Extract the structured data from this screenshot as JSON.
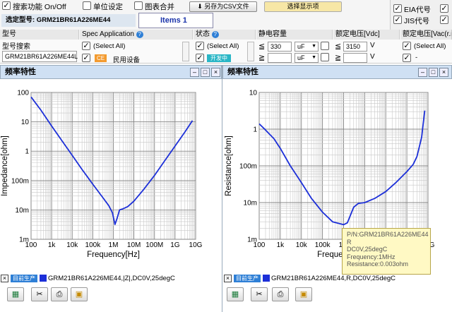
{
  "topbar": {
    "search_toggle": "搜索功能 On/Off",
    "unit_setting": "单位设定",
    "chart_merge": "图表合并",
    "csv_button": "另存为CSV文件",
    "select_display_button": "选择显示项",
    "selected_label": "选定型号: GRM21BR61A226ME44",
    "items_count": "Items 1",
    "right_options": [
      "EIA代号",
      "JIS代号"
    ]
  },
  "filters": {
    "col_model": "型号",
    "model_search_label": "型号搜索",
    "model_search_value": "GRM21BR61A226ME44L",
    "col_spec": "Spec Application",
    "spec_select_all": "(Select All)",
    "spec_ce_badge": "CE",
    "spec_item1": "民用设备",
    "col_status": "状态",
    "status_select_all": "(Select All)",
    "status_item1": "开发中",
    "col_capacitance": "静电容量",
    "cap_op1": "≦",
    "cap_value": "330",
    "cap_unit": "uF",
    "cap_op2": "≧",
    "col_voltage": "额定电压[Vdc]",
    "volt_op1": "≦",
    "volt_value": "3150",
    "volt_unit": "V",
    "volt_op2": "≧",
    "col_voltage_ac": "额定电压[Vac(r.m",
    "vac_select_all": "(Select All)",
    "vac_item1": "-"
  },
  "left_panel": {
    "title": "频率特性",
    "legend_badge": "目前生产",
    "legend_text": "GRM21BR61A226ME44,|Z|,DC0V,25degC"
  },
  "right_panel": {
    "title": "频率特性",
    "legend_badge": "目前生产",
    "legend_text": "GRM21BR61A226ME44,R,DC0V,25degC"
  },
  "tooltip": {
    "lines": [
      "P/N:GRM21BR61A226ME44",
      "R",
      "DC0V,25degC",
      "Frequency:1MHz",
      "Resistance:0.003ohm"
    ]
  },
  "toolbar_icons": [
    "excel-icon",
    "tools-icon",
    "print-icon",
    "image-icon"
  ],
  "chart_data": [
    {
      "type": "line",
      "xlabel": "Frequency[Hz]",
      "ylabel": "Impedance[ohm]",
      "x_scale": "log",
      "y_scale": "log",
      "xlim": [
        100,
        10000000000
      ],
      "ylim": [
        0.001,
        100
      ],
      "x_ticks": [
        "100",
        "1k",
        "10k",
        "100k",
        "1M",
        "10M",
        "100M",
        "1G",
        "10G"
      ],
      "y_ticks": [
        "100",
        "10",
        "1",
        "100m",
        "10m",
        "1m"
      ],
      "grid": true,
      "color": "#1c2fd8",
      "series": [
        {
          "x": [
            100,
            300,
            1000,
            3000,
            10000,
            30000,
            100000,
            300000,
            600000,
            900000,
            1200000,
            1500000,
            2000000,
            3000000,
            5000000,
            10000000,
            30000000,
            100000000,
            300000000,
            1000000000,
            3000000000,
            7000000000
          ],
          "y": [
            70,
            25,
            7.2,
            2.4,
            0.72,
            0.24,
            0.075,
            0.027,
            0.014,
            0.008,
            0.0032,
            0.005,
            0.01,
            0.011,
            0.013,
            0.02,
            0.05,
            0.15,
            0.45,
            1.5,
            4.5,
            11
          ]
        }
      ]
    },
    {
      "type": "line",
      "xlabel": "Frequency[Hz]",
      "ylabel": "Resistance[ohm]",
      "x_scale": "log",
      "y_scale": "log",
      "xlim": [
        100,
        10000000000
      ],
      "ylim": [
        0.001,
        10
      ],
      "x_ticks": [
        "100",
        "1k",
        "10k",
        "100k",
        "1M",
        "10M",
        "100M",
        "1G",
        "10G"
      ],
      "y_ticks": [
        "10",
        "1",
        "100m",
        "10m",
        "1m"
      ],
      "grid": true,
      "color": "#1c2fd8",
      "series": [
        {
          "x": [
            100,
            200,
            500,
            1000,
            3000,
            10000,
            30000,
            100000,
            300000,
            1000000,
            1500000,
            2000000,
            3000000,
            5000000,
            10000000,
            30000000,
            100000000,
            300000000,
            1000000000,
            2000000000,
            3000000000,
            5000000000,
            7000000000
          ],
          "y": [
            1.4,
            0.95,
            0.55,
            0.3,
            0.1,
            0.035,
            0.013,
            0.0055,
            0.003,
            0.0025,
            0.0028,
            0.0042,
            0.0075,
            0.0095,
            0.01,
            0.013,
            0.02,
            0.035,
            0.07,
            0.11,
            0.18,
            0.6,
            3.2
          ]
        }
      ]
    }
  ]
}
